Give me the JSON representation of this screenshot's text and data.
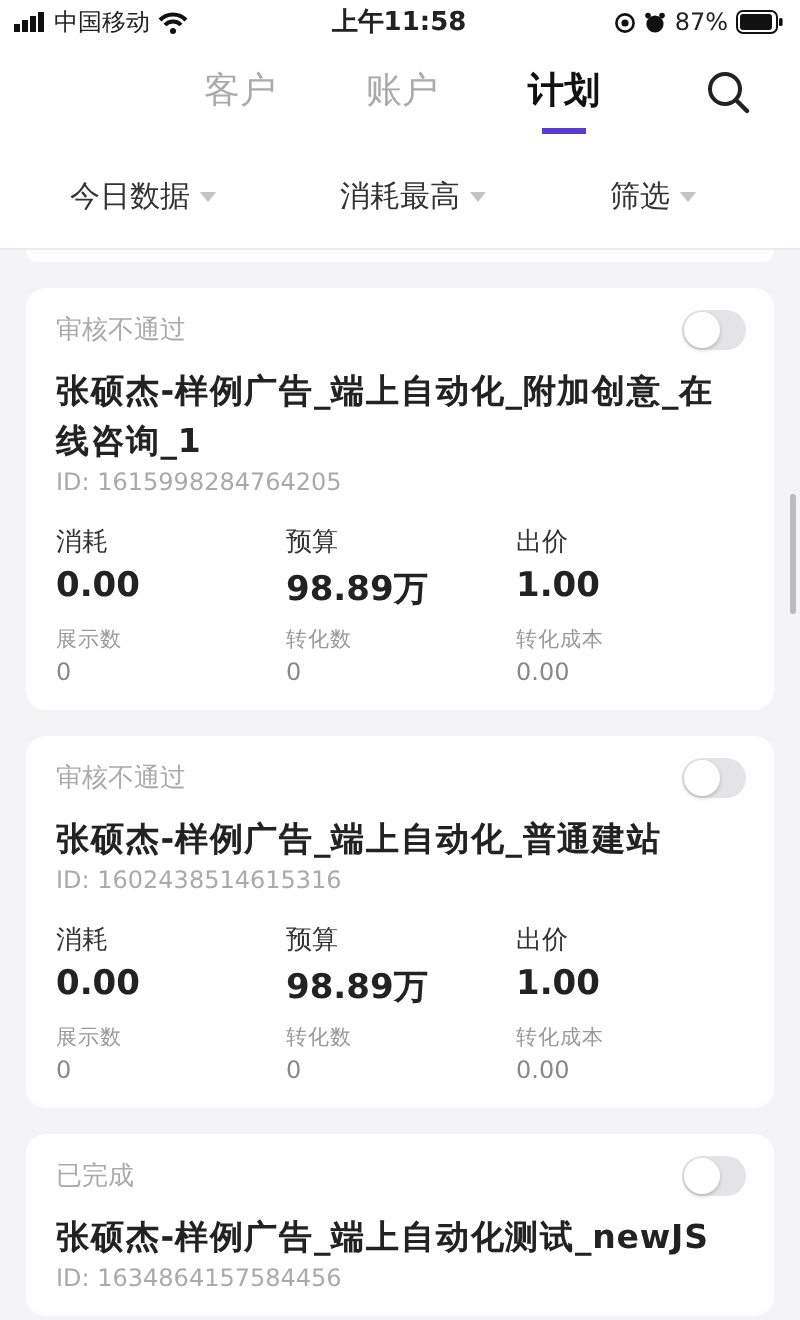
{
  "status_bar": {
    "carrier": "中国移动",
    "time": "上午11:58",
    "battery": "87%"
  },
  "tabs": [
    {
      "label": "客户",
      "selected": false
    },
    {
      "label": "账户",
      "selected": false
    },
    {
      "label": "计划",
      "selected": true
    }
  ],
  "filters": [
    {
      "label": "今日数据"
    },
    {
      "label": "消耗最高"
    },
    {
      "label": "筛选"
    }
  ],
  "campaigns": [
    {
      "status": "审核不通过",
      "on": false,
      "name": "张硕杰-样例广告_端上自动化_附加创意_在线咨询_1",
      "id": "ID: 1615998284764205",
      "metrics": [
        {
          "label": "消耗",
          "value": "0.00"
        },
        {
          "label": "预算",
          "value": "98.89万"
        },
        {
          "label": "出价",
          "value": "1.00"
        }
      ],
      "stats": [
        {
          "label": "展示数",
          "value": "0"
        },
        {
          "label": "转化数",
          "value": "0"
        },
        {
          "label": "转化成本",
          "value": "0.00"
        }
      ]
    },
    {
      "status": "审核不通过",
      "on": false,
      "name": "张硕杰-样例广告_端上自动化_普通建站",
      "id": "ID: 1602438514615316",
      "metrics": [
        {
          "label": "消耗",
          "value": "0.00"
        },
        {
          "label": "预算",
          "value": "98.89万"
        },
        {
          "label": "出价",
          "value": "1.00"
        }
      ],
      "stats": [
        {
          "label": "展示数",
          "value": "0"
        },
        {
          "label": "转化数",
          "value": "0"
        },
        {
          "label": "转化成本",
          "value": "0.00"
        }
      ]
    },
    {
      "status": "已完成",
      "on": false,
      "name": "张硕杰-样例广告_端上自动化测试_newJS",
      "id": "ID: 1634864157584456"
    }
  ]
}
